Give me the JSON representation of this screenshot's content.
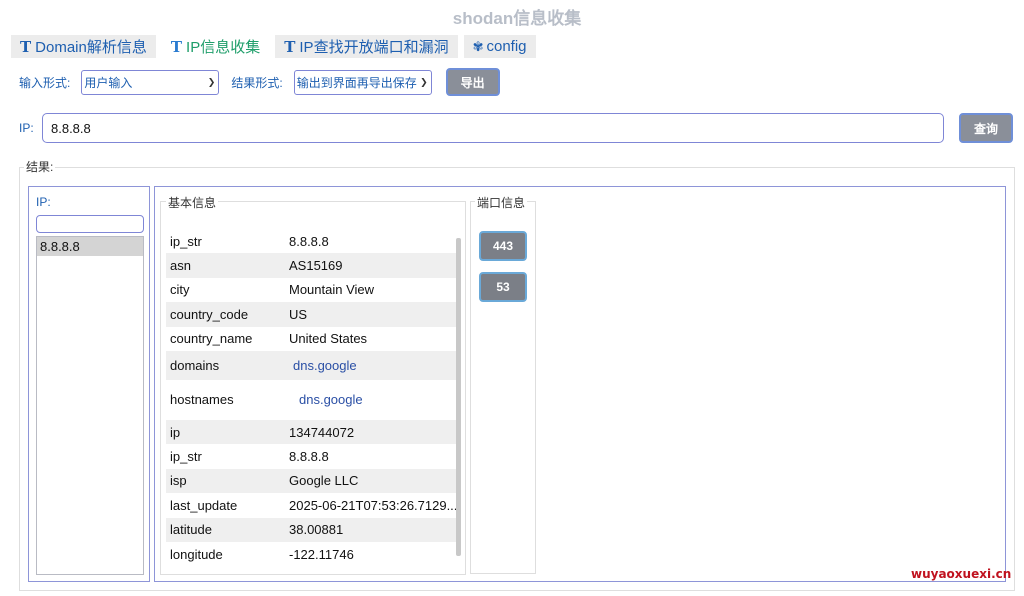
{
  "window": {
    "title": "shodan信息收集"
  },
  "tabs": [
    {
      "icon": "T",
      "label": "Domain解析信息",
      "active": false
    },
    {
      "icon": "T",
      "label": "IP信息收集",
      "active": true
    },
    {
      "icon": "T",
      "label": "IP查找开放端口和漏洞",
      "active": false
    },
    {
      "icon": "gear-icon",
      "label": "config",
      "active": false
    }
  ],
  "options": {
    "input_label": "输入形式:",
    "input_value": "用户输入",
    "result_label": "结果形式:",
    "result_value": "输出到界面再导出保存",
    "export_label": "导出"
  },
  "query": {
    "ip_label": "IP:",
    "ip_value": "8.8.8.8",
    "button_label": "查询"
  },
  "results": {
    "title": "结果:",
    "ip_panel": {
      "label": "IP:",
      "filter_value": "",
      "items": [
        "8.8.8.8"
      ]
    },
    "basic_info": {
      "title": "基本信息",
      "rows": [
        {
          "key": "ip_str",
          "value": "8.8.8.8"
        },
        {
          "key": "asn",
          "value": "AS15169"
        },
        {
          "key": "city",
          "value": "Mountain View"
        },
        {
          "key": "country_code",
          "value": "US"
        },
        {
          "key": "country_name",
          "value": "United States"
        },
        {
          "key": "domains",
          "value": "dns.google"
        },
        {
          "key": "hostnames",
          "value": "dns.google"
        },
        {
          "key": "ip",
          "value": "134744072"
        },
        {
          "key": "ip_str",
          "value": "8.8.8.8"
        },
        {
          "key": "isp",
          "value": "Google LLC"
        },
        {
          "key": "last_update",
          "value": "2025-06-21T07:53:26.7129..."
        },
        {
          "key": "latitude",
          "value": "38.00881"
        },
        {
          "key": "longitude",
          "value": "-122.11746"
        }
      ]
    },
    "port_info": {
      "title": "端口信息",
      "ports": [
        "443",
        "53"
      ]
    }
  },
  "watermark": "wuyaoxuexi.cn",
  "colors": {
    "accent_blue": "#1e5fb0",
    "active_tab_green": "#1e9e6a",
    "button_gray": "#8a8f99",
    "border_blue": "#7f86d6",
    "watermark_red": "#c0121f"
  }
}
